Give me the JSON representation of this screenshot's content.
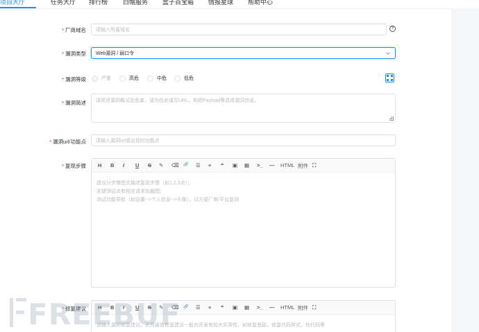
{
  "nav": {
    "tabs": [
      "项目大厅",
      "任务大厅",
      "排行榜",
      "白帽服务",
      "盒子百宝箱",
      "情报星球",
      "帮助中心"
    ],
    "active_index": 0,
    "active_color": "#1890ff"
  },
  "form": {
    "vendor": {
      "label": "厂商域名",
      "placeholder": "请输入所属域名"
    },
    "vuln_type": {
      "label": "漏洞类型",
      "value": "Web漏洞 / 弱口令"
    },
    "vuln_level": {
      "label": "漏洞等级",
      "options": [
        "严重",
        "高危",
        "中危",
        "低危"
      ]
    },
    "vuln_summary": {
      "label": "漏洞简述",
      "placeholder": "请简述漏洞概况及危害，请勿在此填写URL，和把Payload等具体漏洞信息。"
    },
    "vuln_url": {
      "label": "漏洞url/功能点",
      "placeholder": "请输入漏洞url或出现的功能点"
    },
    "repro_steps": {
      "label": "复现步骤",
      "placeholder_lines": [
        "建议分步骤图文描述复现步骤（如1,2,3点）；",
        "关键测试点有相关请求包截图；",
        "测试功能导航（如设置-->个人信息-->头像），以方便厂商/平台复测"
      ]
    },
    "fix_suggestion": {
      "label": "修复建议",
      "placeholder": "请输入漏洞修复建议。优秀报告修复建议一般对开发有较大实用性，如修复思路，修复代码样式，伪代码等"
    }
  },
  "toolbar": {
    "items": [
      "H",
      "B",
      "I",
      "U",
      "S",
      "✎",
      "⌫",
      "🔗",
      "☰",
      "≡",
      "❝",
      "▣",
      "▦",
      ">_",
      "—"
    ],
    "html_label": "HTML",
    "attach_label": "附件",
    "fullscreen_glyph": "⛶"
  },
  "watermark": {
    "text": "FREEBUF"
  },
  "colors": {
    "accent": "#1890ff",
    "required": "#f5222d",
    "panel": "#f4f6fa"
  }
}
